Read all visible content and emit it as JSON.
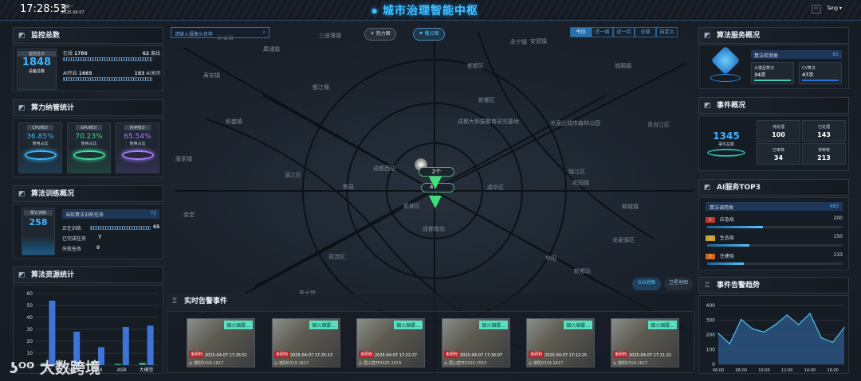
{
  "header": {
    "time": "17:28:53",
    "weekday": "星期一",
    "date": "2025.04.07",
    "title": "城市治理智能中枢",
    "user": "Tang"
  },
  "search": {
    "placeholder": "请输入摄像头名称"
  },
  "map_controls": {
    "heatmap": "热力图",
    "scatter": "撒点图",
    "time_tabs": [
      "今日",
      "近一周",
      "近一月",
      "全部",
      "自定义"
    ],
    "gis": "GIS地图",
    "satellite": "卫星地图"
  },
  "map_labels": [
    "三道堰镇",
    "东坡镇",
    "寿安镇",
    "都江堰",
    "安德镇",
    "郫都区",
    "新都区",
    "城厢镇",
    "犀浦镇",
    "成都大熊猫繁育研究基地",
    "和盛镇",
    "唐家镇",
    "温江区",
    "青白江区",
    "成都西站",
    "锦江区",
    "成华区",
    "武侯区",
    "龙泉驿区",
    "双流区",
    "成都南站",
    "华阳",
    "黄水镇",
    "永宁镇",
    "龙泉山城市森林公园",
    "新都站",
    "金堂",
    "郫县",
    "柳城镇",
    "花园镇"
  ],
  "map_markers": {
    "cluster1": "2个",
    "cluster2": "4"
  },
  "monitor": {
    "title": "监控总数",
    "total_label": "监控总计",
    "total": "1848",
    "total_sub": "设备总数",
    "online_label": "在线",
    "online": "1786",
    "offline": "62",
    "offline_label": "离线",
    "ai_on_label": "AI开启",
    "ai_on": "1665",
    "ai_off": "183",
    "ai_off_label": "AI关闭"
  },
  "compute": {
    "title": "算力纳管统计",
    "items": [
      {
        "label": "CPU统计",
        "value": "36.85%",
        "sub": "使用占比",
        "color": "#39b8ff"
      },
      {
        "label": "GPU统计",
        "value": "70.23%",
        "sub": "使用占比",
        "color": "#3fdc9a"
      },
      {
        "label": "内存统计",
        "value": "65.54%",
        "sub": "使用占比",
        "color": "#a97cff"
      }
    ]
  },
  "training": {
    "title": "算法训练概况",
    "total_label": "累计训练",
    "total": "258",
    "current_label": "当前算法训练任务",
    "current": "72",
    "training_label": "正在训练",
    "training": "65",
    "done_label": "已完成任务",
    "done": "7",
    "failed_label": "失败任务",
    "failed": "0"
  },
  "chart_data": [
    {
      "type": "bar",
      "title": "算法资源统计",
      "categories": [
        "CV",
        "NLP",
        "OCR",
        "ASR",
        "大模型"
      ],
      "ylim": [
        0,
        60
      ],
      "yticks": [
        0,
        10,
        20,
        30,
        40,
        50,
        60
      ],
      "series": [
        {
          "name": "green",
          "values": [
            2,
            0,
            2,
            1,
            2
          ],
          "color": "#3aa17e"
        },
        {
          "name": "blue",
          "values": [
            54,
            28,
            15,
            32,
            33
          ],
          "color": "#3d74d6"
        }
      ]
    },
    {
      "type": "area",
      "title": "事件告警趋势",
      "x": [
        "06:00",
        "07:00",
        "08:00",
        "09:00",
        "10:00",
        "11:00",
        "12:00",
        "13:00",
        "14:00",
        "15:00",
        "16:00",
        "17:00"
      ],
      "xticks": [
        "06:00",
        "08:00",
        "10:00",
        "12:00",
        "14:00",
        "16:00"
      ],
      "values": [
        210,
        140,
        305,
        240,
        220,
        270,
        335,
        270,
        345,
        180,
        150,
        250
      ],
      "ylim": [
        0,
        400
      ],
      "yticks": [
        0,
        100,
        200,
        300,
        400
      ]
    }
  ],
  "algo_service": {
    "title": "算法服务概况",
    "category": "算法检测类",
    "count": "81",
    "items": [
      {
        "label": "大模型算法",
        "value": "34次"
      },
      {
        "label": "CV算法",
        "value": "47次"
      }
    ]
  },
  "events": {
    "title": "事件概况",
    "total": "1345",
    "total_label": "事件总数",
    "stats": [
      {
        "label": "待处理",
        "value": "100"
      },
      {
        "label": "已处理",
        "value": "143"
      },
      {
        "label": "已审核",
        "value": "34"
      },
      {
        "label": "待审核",
        "value": "213"
      }
    ]
  },
  "top3": {
    "title": "AI服务TOP3",
    "header": "算法调用类",
    "total": "483",
    "items": [
      {
        "rank": "1",
        "name": "应急局",
        "value": "200",
        "pct": 41
      },
      {
        "rank": "2",
        "name": "生态局",
        "value": "150",
        "pct": 31
      },
      {
        "rank": "3",
        "name": "住建局",
        "value": "133",
        "pct": 27
      }
    ],
    "rank_colors": [
      "#c0392b",
      "#c9a227",
      "#d2691e"
    ]
  },
  "alerts": {
    "title": "实时告警事件",
    "items": [
      {
        "tag": "烟火烟雾...",
        "status": "未研判",
        "time": "2025-04-07 17:26:51",
        "loc": "德阳0319-1617"
      },
      {
        "tag": "烟火烟雾...",
        "status": "未研判",
        "time": "2025-04-07 17:25:13",
        "loc": "德阳0319-1617"
      },
      {
        "tag": "烟火烟雾...",
        "status": "未研判",
        "time": "2025-04-07 17:22:27",
        "loc": "眉山营开0325-1553"
      },
      {
        "tag": "烟火烟雾...",
        "status": "未研判",
        "time": "2025-04-07 17:16:07",
        "loc": "眉山营开0325-1553"
      },
      {
        "tag": "烟火烟雾...",
        "status": "未研判",
        "time": "2025-04-07 17:12:25",
        "loc": "德阳0319-1617"
      },
      {
        "tag": "烟火烟雾...",
        "status": "未研判",
        "time": "2025-04-07 17:11:21",
        "loc": "德阳0319-1617"
      }
    ]
  },
  "watermark": "大数跨境"
}
